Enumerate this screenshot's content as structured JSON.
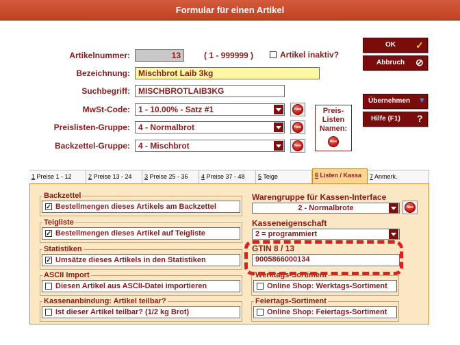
{
  "window": {
    "title": "Formular für einen Artikel"
  },
  "header": {
    "artikelnummer": {
      "label": "Artikelnummer:",
      "value": "13",
      "range": "( 1 - 999999 )"
    },
    "inaktiv": {
      "label": "Artikel inaktiv?",
      "checked": false
    },
    "bezeichnung": {
      "label": "Bezeichnung:",
      "value": "Mischbrot Laib 3kg"
    },
    "suchbegriff": {
      "label": "Suchbegriff:",
      "value": "MISCHBROTLAIB3KG"
    },
    "mwst": {
      "label": "MwSt-Code:",
      "value": "1 - 10.00% - Satz #1"
    },
    "preisliste": {
      "label": "Preislisten-Gruppe:",
      "value": "4 - Normalbrot"
    },
    "backzettel": {
      "label": "Backzettel-Gruppe:",
      "value": "4 - Mischbrot"
    },
    "new_label": "New",
    "preis_namen": {
      "line1": "Preis-",
      "line2": "Listen",
      "line3": "Namen:"
    }
  },
  "buttons": {
    "ok": "OK",
    "abbruch": "Abbruch",
    "uebernehmen": "Übernehmen",
    "hilfe": "Hilfe (F1)"
  },
  "tabs": [
    {
      "key": "1",
      "label": " Preise 1 - 12"
    },
    {
      "key": "2",
      "label": " Preise 13 - 24"
    },
    {
      "key": "3",
      "label": " Preise 25 - 36"
    },
    {
      "key": "4",
      "label": " Preise 37 - 48"
    },
    {
      "key": "5",
      "label": " Teige"
    },
    {
      "key": "6",
      "label": " Listen / Kassa"
    },
    {
      "key": "7",
      "label": " Anmerk."
    }
  ],
  "left_groups": [
    {
      "title": "Backzettel",
      "text": "Bestellmengen dieses Artikels am Backzettel",
      "checked": true
    },
    {
      "title": "Teigliste",
      "text": "Bestellmengen dieses Artikel auf Teigliste",
      "checked": true
    },
    {
      "title": "Statistiken",
      "text": "Umsätze dieses Artikels in den Statistiken",
      "checked": true
    },
    {
      "title": "ASCII Import",
      "text": "Diesen Artikel aus ASCII-Datei importieren",
      "checked": false
    },
    {
      "title": "Kassenanbindung: Artikel teilbar?",
      "text": "Ist dieser Artikel teilbar? (1/2 kg Brot)",
      "checked": false
    }
  ],
  "right": {
    "warengruppe": {
      "label": "Warengruppe für Kassen-Interface",
      "value": "2 - Normalbrote"
    },
    "kasseneigenschaft": {
      "label": "Kasseneigenschaft",
      "value": "2 = programmiert"
    },
    "gtin": {
      "label": "GTIN 8 / 13",
      "value": "9005866000134"
    },
    "werktags": {
      "title": "Werktags-Sortiment",
      "text": "Online Shop: Werktags-Sortiment",
      "checked": false
    },
    "feiertags": {
      "title": "Feiertags-Sortiment",
      "text": "Online Shop: Feiertags-Sortiment",
      "checked": false
    }
  },
  "colors": {
    "title_bar": "#c84a2a",
    "label_text": "#8b1a1a",
    "button_bg": "#7a0c0c",
    "panel_bg": "#fbe7c3",
    "active_tab": "#fbd691",
    "highlight_dash": "#e02020",
    "yellow_field": "#fbf7a3"
  }
}
